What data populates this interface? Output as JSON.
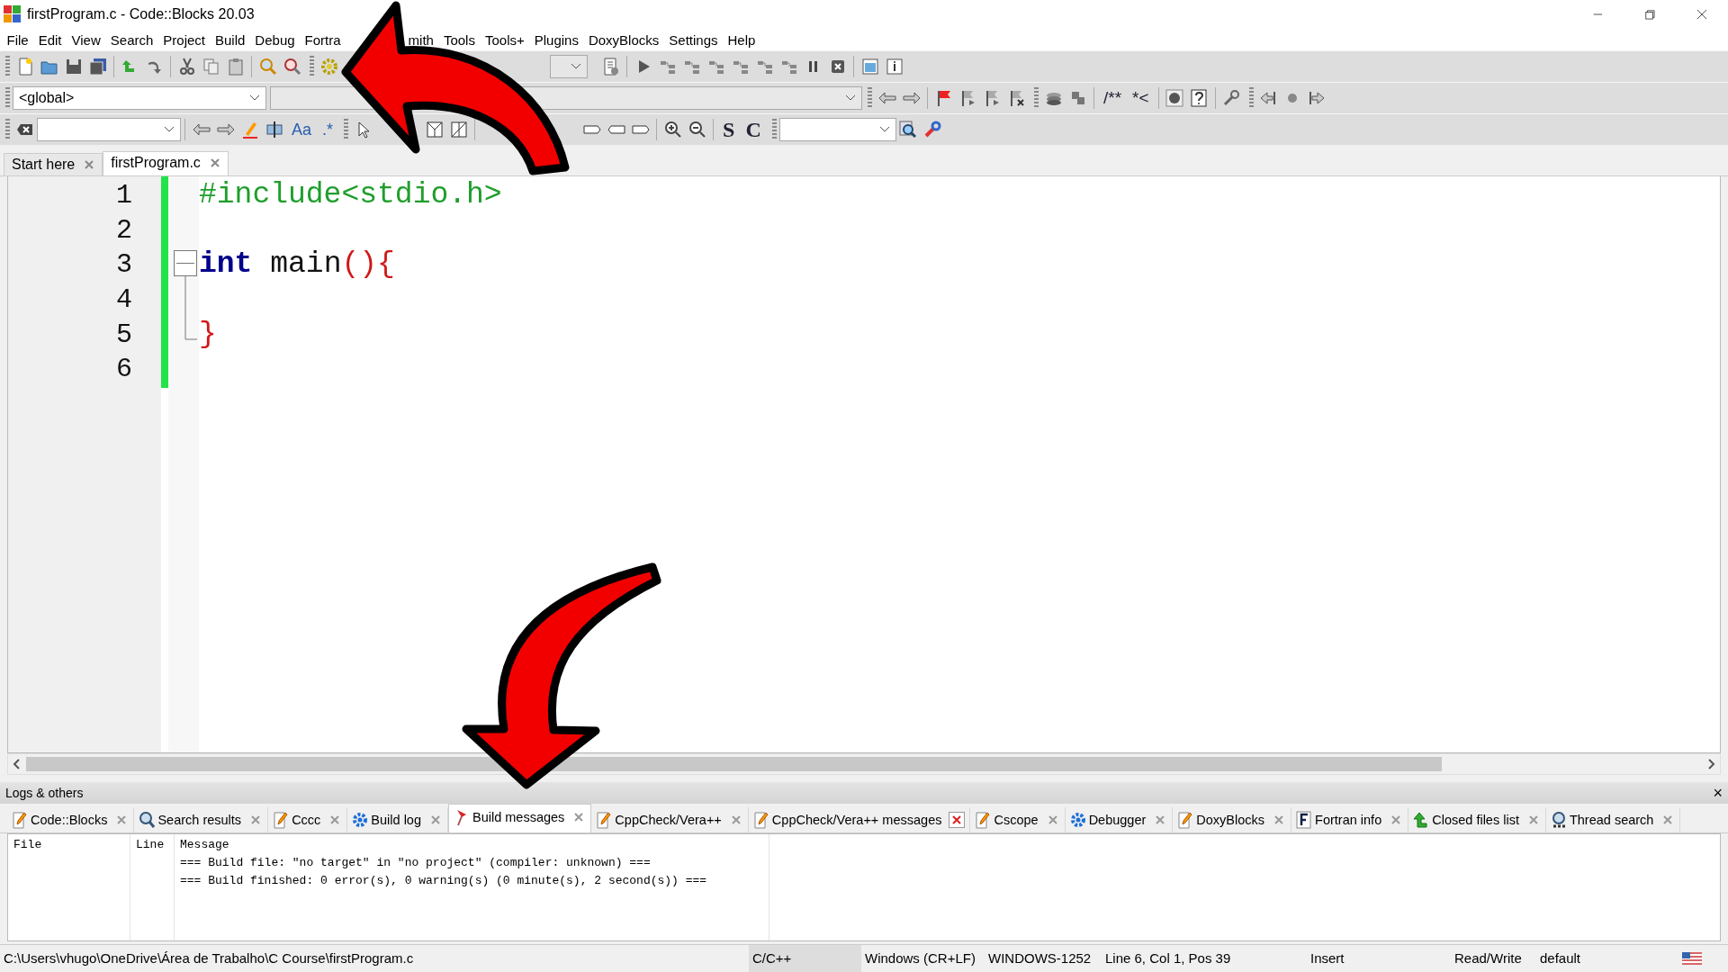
{
  "window": {
    "title": "firstProgram.c - Code::Blocks 20.03"
  },
  "menu": [
    "File",
    "Edit",
    "View",
    "Search",
    "Project",
    "Build",
    "Debug",
    "Fortra",
    "mith",
    "Tools",
    "Tools+",
    "Plugins",
    "DoxyBlocks",
    "Settings",
    "Help"
  ],
  "toolbar": {
    "scope": "<global>",
    "comment_buttons": [
      "/**",
      "*<"
    ],
    "match_case": "Aa",
    "regex": ".*",
    "letters": [
      "S",
      "C"
    ]
  },
  "editor_tabs": [
    {
      "label": "Start here",
      "selected": false
    },
    {
      "label": "firstProgram.c",
      "selected": true
    }
  ],
  "editor": {
    "lines": [
      {
        "number": "1",
        "tokens": [
          {
            "kind": "preprocessor",
            "text": "#include<stdio.h>"
          }
        ]
      },
      {
        "number": "2"
      },
      {
        "number": "3",
        "tokens": [
          {
            "kind": "keyword",
            "text": "int"
          },
          {
            "kind": "plain",
            "text": " main"
          },
          {
            "kind": "brace",
            "text": "(){"
          }
        ]
      },
      {
        "number": "4"
      },
      {
        "number": "5",
        "tokens": [
          {
            "kind": "brace",
            "text": "}"
          }
        ]
      },
      {
        "number": "6"
      }
    ]
  },
  "logs": {
    "title": "Logs & others",
    "close": "×",
    "tabs": [
      {
        "label": "Code::Blocks",
        "selected": false,
        "close_hovered": false
      },
      {
        "label": "Search results",
        "selected": false,
        "close_hovered": false
      },
      {
        "label": "Cccc",
        "selected": false,
        "close_hovered": false
      },
      {
        "label": "Build log",
        "selected": false,
        "close_hovered": false
      },
      {
        "label": "Build messages",
        "selected": true,
        "close_hovered": false
      },
      {
        "label": "CppCheck/Vera++",
        "selected": false,
        "close_hovered": false
      },
      {
        "label": "CppCheck/Vera++ messages",
        "selected": false,
        "close_hovered": true
      },
      {
        "label": "Cscope",
        "selected": false,
        "close_hovered": false
      },
      {
        "label": "Debugger",
        "selected": false,
        "close_hovered": false
      },
      {
        "label": "DoxyBlocks",
        "selected": false,
        "close_hovered": false
      },
      {
        "label": "Fortran info",
        "selected": false,
        "close_hovered": false
      },
      {
        "label": "Closed files list",
        "selected": false,
        "close_hovered": false
      },
      {
        "label": "Thread search",
        "selected": false,
        "close_hovered": false
      }
    ],
    "columns": [
      "File",
      "Line",
      "Message"
    ],
    "rows": [
      {
        "message": "=== Build file: \"no target\" in \"no project\" (compiler: unknown) ==="
      },
      {
        "message": "=== Build finished: 0 error(s), 0 warning(s) (0 minute(s), 2 second(s)) ==="
      }
    ]
  },
  "status_bar": [
    "C:\\Users\\vhugo\\OneDrive\\Área de Trabalho\\C Course\\firstProgram.c",
    "C/C++",
    "Windows (CR+LF)",
    "WINDOWS-1252",
    "Line 6, Col 1, Pos 39",
    "Insert",
    "Read/Write",
    "default"
  ]
}
